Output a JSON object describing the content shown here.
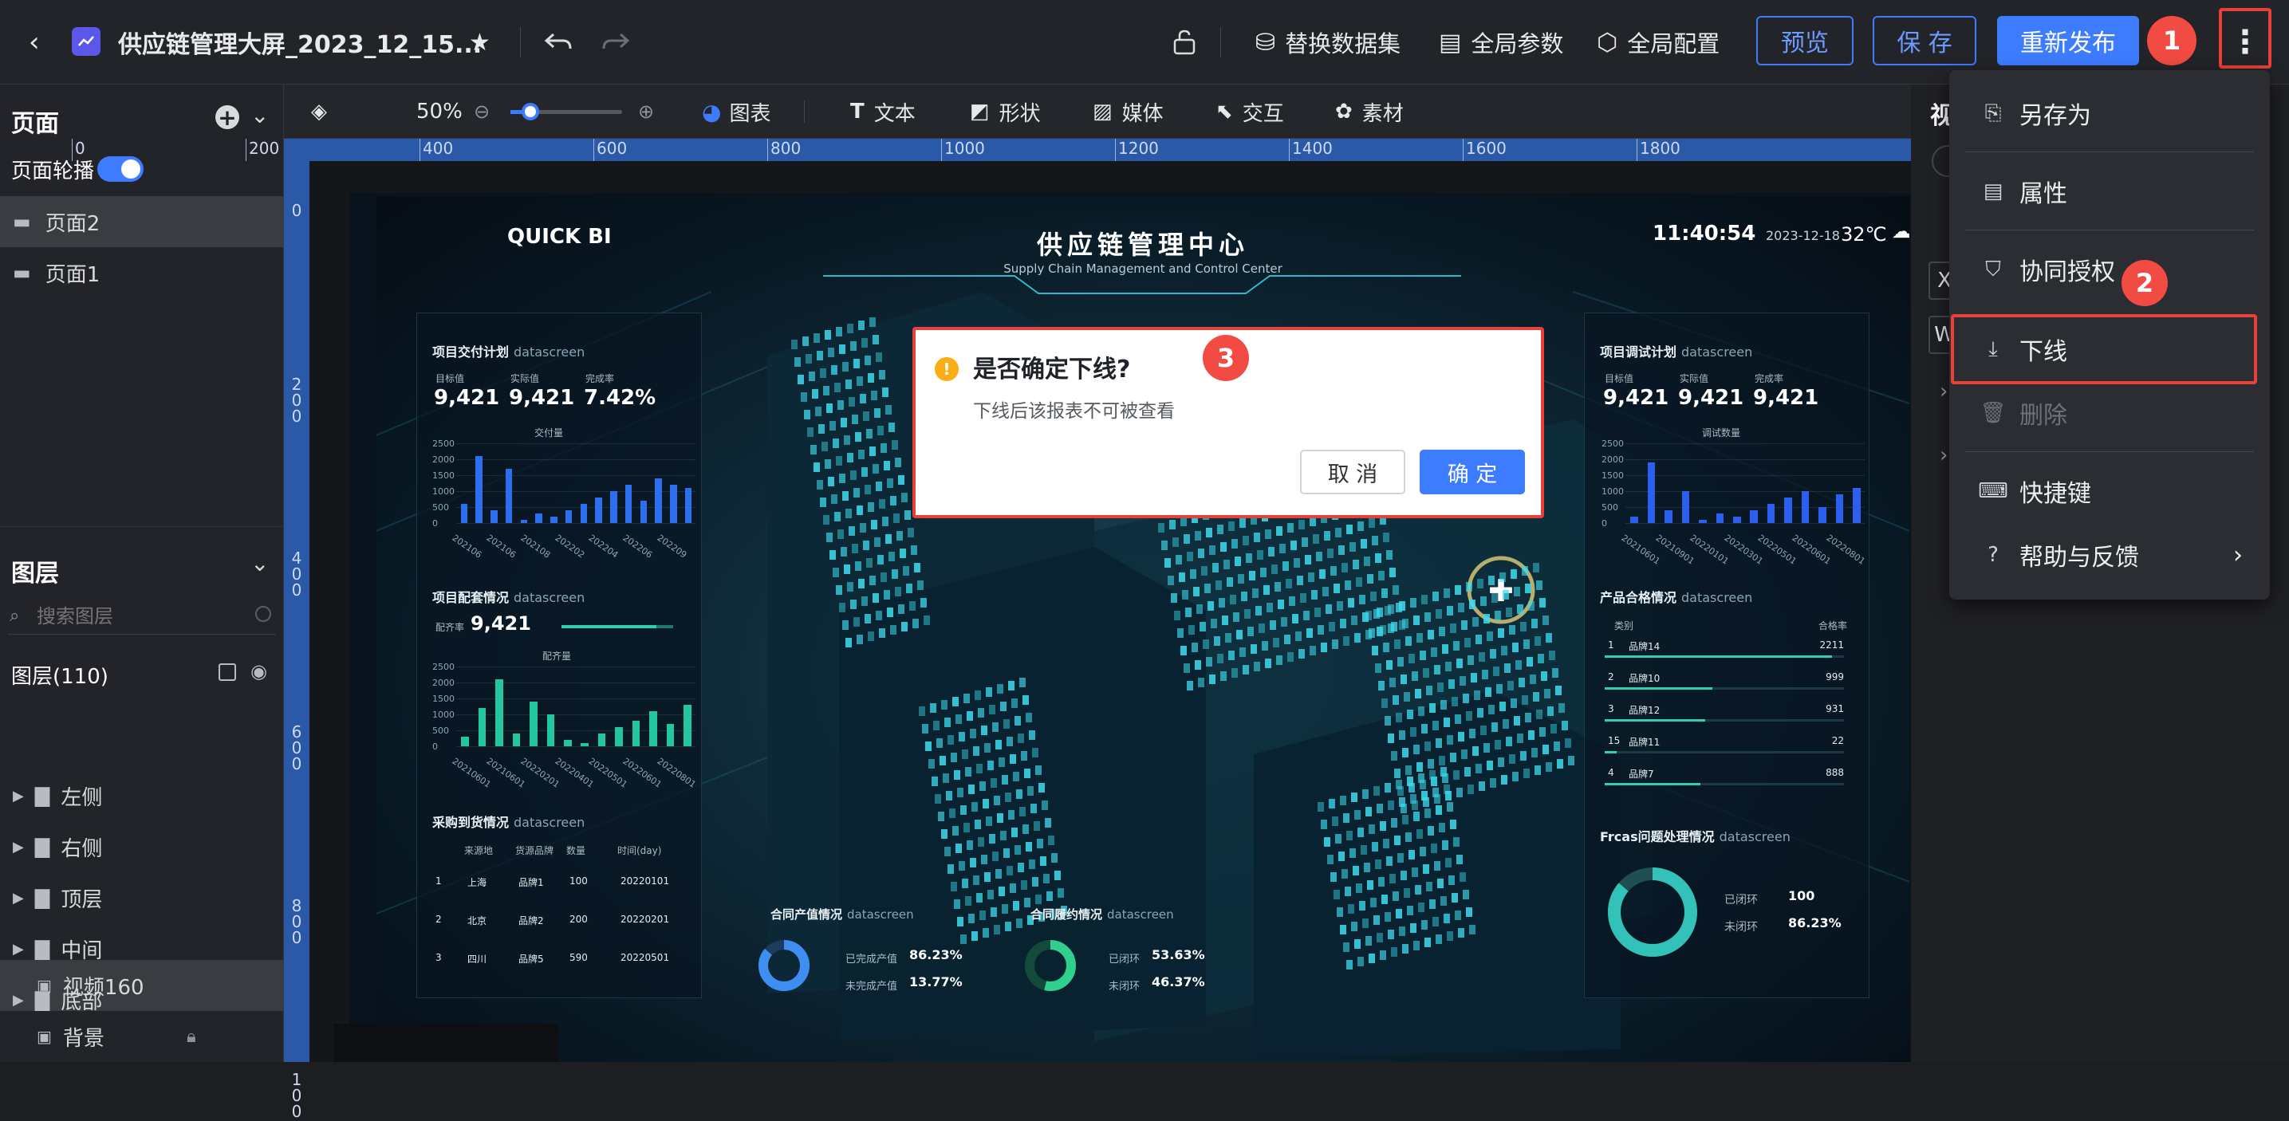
{
  "topbar": {
    "title": "供应链管理大屏_2023_12_15...",
    "replace_dataset": "替换数据集",
    "global_params": "全局参数",
    "global_config": "全局配置",
    "preview": "预览",
    "save": "保 存",
    "republish": "重新发布"
  },
  "badges": {
    "one": "1",
    "two": "2",
    "three": "3"
  },
  "left": {
    "pages_title": "页面",
    "carousel": "页面轮播",
    "pages": [
      "页面2",
      "页面1"
    ],
    "layers_title": "图层",
    "search_placeholder": "搜索图层",
    "layers_count": "图层(110)",
    "groups": [
      "左侧",
      "右侧",
      "顶层",
      "中间",
      "底部"
    ],
    "video": "视频160",
    "background": "背景"
  },
  "toolbar": {
    "zoom": "50%",
    "chart": "图表",
    "text": "文本",
    "shape": "形状",
    "media": "媒体",
    "interact": "交互",
    "material": "素材"
  },
  "ruler": {
    "h": [
      "0",
      "200",
      "400",
      "600",
      "800",
      "1000",
      "1200",
      "1400",
      "1600",
      "1800"
    ],
    "v": [
      "0",
      "200",
      "400",
      "600",
      "800",
      "100"
    ]
  },
  "dashboard": {
    "brand": "QUICK BI",
    "title": "供应链管理中心",
    "subtitle": "Supply Chain Management and Control Center",
    "time": "11:40:54",
    "date": "2023-12-18",
    "temp": "32℃",
    "p1": {
      "title": "项目交付计划",
      "ds": "datascreen",
      "l1": "目标值",
      "l2": "实际值",
      "l3": "完成率",
      "v1": "9,421",
      "v2": "9,421",
      "v3": "7.42%",
      "legend": "交付量",
      "yticks": [
        "2500",
        "2000",
        "1500",
        "1000",
        "500",
        "0"
      ],
      "xticks": [
        "202106",
        "202106",
        "202108",
        "202202",
        "202204",
        "202206",
        "202209"
      ],
      "values": [
        600,
        2100,
        400,
        1700,
        100,
        300,
        200,
        400,
        600,
        800,
        1000,
        1200,
        700,
        1400,
        1200,
        1100
      ]
    },
    "p2": {
      "title": "项目配套情况",
      "ds": "datascreen",
      "label": "配齐率",
      "value": "9,421",
      "legend": "配齐量",
      "yticks": [
        "2500",
        "2000",
        "1500",
        "1000",
        "500",
        "0"
      ],
      "xticks": [
        "20210601",
        "20210601",
        "20220201",
        "20220401",
        "20220501",
        "20220601",
        "20220801"
      ],
      "values": [
        300,
        1200,
        2100,
        400,
        1400,
        1000,
        200,
        100,
        400,
        600,
        800,
        1100,
        700,
        1300
      ]
    },
    "p3": {
      "title": "采购到货情况",
      "ds": "datascreen",
      "headers": [
        "来源地",
        "货源品牌",
        "数量",
        "时间(day)"
      ],
      "rows": [
        [
          "1",
          "上海",
          "品牌1",
          "100",
          "20220101"
        ],
        [
          "2",
          "北京",
          "品牌2",
          "200",
          "20220201"
        ],
        [
          "3",
          "四川",
          "品牌5",
          "590",
          "20220501"
        ]
      ]
    },
    "r1": {
      "title": "项目调试计划",
      "ds": "datascreen",
      "l1": "目标值",
      "l2": "实际值",
      "l3": "完成率",
      "v1": "9,421",
      "v2": "9,421",
      "v3": "9,421",
      "legend": "调试数量",
      "yticks": [
        "2500",
        "2000",
        "1500",
        "1000",
        "500",
        "0"
      ],
      "xticks": [
        "20210601",
        "20210901",
        "20220101",
        "20220301",
        "20220501",
        "20220601",
        "20220801"
      ],
      "values": [
        200,
        1900,
        400,
        1000,
        100,
        300,
        200,
        400,
        600,
        800,
        1000,
        500,
        900,
        1100
      ]
    },
    "r2": {
      "title": "产品合格情况",
      "ds": "datascreen",
      "h1": "类别",
      "h2": "合格率",
      "rows": [
        [
          "1",
          "品牌14",
          "2211"
        ],
        [
          "2",
          "品牌10",
          "999"
        ],
        [
          "3",
          "品牌12",
          "931"
        ],
        [
          "15",
          "品牌11",
          "22"
        ],
        [
          "4",
          "品牌7",
          "888"
        ]
      ],
      "fills": [
        0.95,
        0.45,
        0.42,
        0.05,
        0.4
      ]
    },
    "r3": {
      "title": "Frcas问题处理情况",
      "ds": "datascreen",
      "a": "已闭环",
      "av": "100",
      "b": "未闭环",
      "bv": "86.23%"
    },
    "b1": {
      "title": "合同产值情况",
      "ds": "datascreen",
      "a": "已完成产值",
      "av": "86.23%",
      "b": "未完成产值",
      "bv": "13.77%"
    },
    "b2": {
      "title": "合同履约情况",
      "ds": "datascreen",
      "a": "已闭环",
      "av": "53.63%",
      "b": "未闭环",
      "bv": "46.37%"
    }
  },
  "dialog": {
    "title": "是否确定下线?",
    "body": "下线后该报表不可被查看",
    "cancel": "取 消",
    "ok": "确 定"
  },
  "menu": {
    "save_as": "另存为",
    "properties": "属性",
    "collab": "协同授权",
    "offline": "下线",
    "delete": "删除",
    "shortcuts": "快捷键",
    "help": "帮助与反馈"
  },
  "right": {
    "tab": "视",
    "f1": "X",
    "f2": "W"
  },
  "colors": {
    "accent": "#3d7cff",
    "highlight": "#e8413a",
    "cyan": "#32d8e8"
  }
}
